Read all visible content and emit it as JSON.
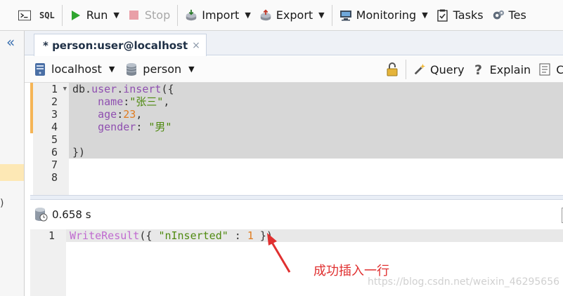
{
  "toolbar": {
    "items": [
      {
        "label": "",
        "icon": "shell-icon"
      },
      {
        "label": "",
        "icon": "sql-icon",
        "glyph": "SQL"
      },
      {
        "label": "Run",
        "icon": "run-icon"
      },
      {
        "label": "Stop",
        "icon": "stop-icon"
      },
      {
        "label": "Import",
        "icon": "import-icon"
      },
      {
        "label": "Export",
        "icon": "export-icon"
      },
      {
        "label": "Monitoring",
        "icon": "monitoring-icon"
      },
      {
        "label": "Tasks",
        "icon": "tasks-icon"
      },
      {
        "label": "Tes",
        "icon": "settings-icon"
      }
    ]
  },
  "tab": {
    "title": "* person:user@localhost",
    "close": "×"
  },
  "connection": {
    "server": "localhost",
    "database": "person",
    "query_label": "Query",
    "explain_label": "Explain",
    "co_label": "Co"
  },
  "editor": {
    "line_numbers": [
      "1",
      "2",
      "3",
      "4",
      "5",
      "6",
      "7",
      "8"
    ],
    "lines": [
      [
        {
          "t": "db.",
          "c": "c-plain"
        },
        {
          "t": "user",
          "c": "c-fn"
        },
        {
          "t": ".",
          "c": "c-plain"
        },
        {
          "t": "insert",
          "c": "c-fn"
        },
        {
          "t": "({",
          "c": "c-plain"
        }
      ],
      [
        {
          "t": "    ",
          "c": "c-plain"
        },
        {
          "t": "name",
          "c": "c-key"
        },
        {
          "t": ":",
          "c": "c-plain"
        },
        {
          "t": "\"张三\"",
          "c": "c-str"
        },
        {
          "t": ",",
          "c": "c-plain"
        }
      ],
      [
        {
          "t": "    ",
          "c": "c-plain"
        },
        {
          "t": "age",
          "c": "c-key"
        },
        {
          "t": ":",
          "c": "c-plain"
        },
        {
          "t": "23",
          "c": "c-num"
        },
        {
          "t": ",",
          "c": "c-plain"
        }
      ],
      [
        {
          "t": "    ",
          "c": "c-plain"
        },
        {
          "t": "gender",
          "c": "c-key"
        },
        {
          "t": ": ",
          "c": "c-plain"
        },
        {
          "t": "\"男\"",
          "c": "c-str"
        }
      ],
      [
        {
          "t": "",
          "c": "c-plain"
        }
      ],
      [
        {
          "t": "})",
          "c": "c-plain"
        }
      ],
      [
        {
          "t": "",
          "c": "c-plain"
        }
      ],
      [
        {
          "t": "",
          "c": "c-plain"
        }
      ]
    ]
  },
  "result": {
    "time": "0.658 s",
    "line_number": "1",
    "tokens": [
      {
        "t": "WriteResult",
        "c": "c-key2"
      },
      {
        "t": "({ ",
        "c": "c-plain"
      },
      {
        "t": "\"nInserted\"",
        "c": "c-str"
      },
      {
        "t": " : ",
        "c": "c-plain"
      },
      {
        "t": "1",
        "c": "c-num"
      },
      {
        "t": " })",
        "c": "c-plain"
      }
    ]
  },
  "annotation": {
    "text": "成功插入一行",
    "color": "#e03030"
  },
  "watermark": "https://blog.csdn.net/weixin_46295656",
  "left_panel": {
    "collapse": "«",
    "partial_text": ")"
  }
}
